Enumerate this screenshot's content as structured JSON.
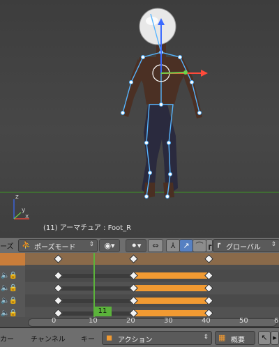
{
  "viewport": {
    "status_text": "(11) アーマチュア : Foot_R",
    "axis_labels": {
      "z": "z",
      "y": "y",
      "x": "x"
    }
  },
  "toolbar": {
    "editor_label": "ーズ",
    "mode_label": "ポーズモード",
    "mode_icon": "pose-person-icon",
    "orientation_label": "グローバル"
  },
  "dopesheet": {
    "current_frame": "11",
    "ruler_ticks": [
      "0",
      "10",
      "20",
      "30",
      "40",
      "50",
      "6"
    ],
    "rows": [
      {
        "type": "summary",
        "keyframes": [
          0,
          20,
          40
        ]
      },
      {
        "type": "channel",
        "keyframes": [
          0,
          20,
          40
        ]
      },
      {
        "type": "channel",
        "keyframes": [
          0,
          20,
          40
        ]
      },
      {
        "type": "channel",
        "keyframes": [
          0,
          20,
          40
        ]
      },
      {
        "type": "channel",
        "keyframes": [
          0,
          20,
          40
        ]
      }
    ],
    "channel_icons": [
      "speaker-icon",
      "lock-icon"
    ]
  },
  "bottombar": {
    "editor_tail": "カー",
    "channel_menu": "チャンネル",
    "key_menu": "キー",
    "action_label": "アクション",
    "summary_label": "概要"
  },
  "colors": {
    "keyframe_bar": "#f19a32",
    "playhead": "#5bb33b",
    "summary_row": "#c97d3a",
    "active_button": "#5680c2"
  }
}
